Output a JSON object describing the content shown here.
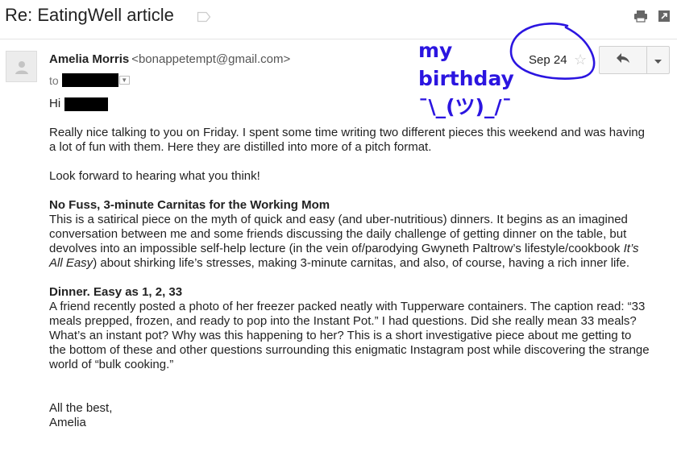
{
  "email": {
    "subject": "Re: EatingWell article",
    "sender_name": "Amelia Morris",
    "sender_email": "<bonappetempt@gmail.com>",
    "to_label": "to",
    "date": "Sep 24",
    "greeting": "Hi",
    "para1": "Really nice talking to you on Friday. I spent some time writing two different pieces this weekend and was having a lot of fun with them. Here they are distilled into more of a pitch format.",
    "para2": "Look forward to hearing what you think!",
    "pitch1_title": "No Fuss, 3-minute Carnitas for the Working Mom",
    "pitch1_body_a": "This is a satirical piece on the myth of quick and easy (and uber-nutritious) dinners. It begins as an imagined conversation between me and some friends discussing the daily challenge of getting dinner on the table, but devolves into an impossible self-help lecture (in the vein of/parodying Gwyneth Paltrow’s lifestyle/cookbook ",
    "pitch1_body_italic": "It’s All Easy",
    "pitch1_body_b": ") about shirking life’s stresses, making 3-minute carnitas, and also, of course, having a rich inner life.",
    "pitch2_title": "Dinner. Easy as 1, 2, 33",
    "pitch2_body": "A friend recently posted a photo of her freezer packed neatly with Tupperware containers. The caption read: “33 meals prepped, frozen, and ready to pop into the Instant Pot.” I had questions. Did she really mean 33 meals? What’s an instant pot? Why was this happening to her? This is a short investigative piece about me getting to the bottom of these and other questions surrounding this enigmatic Instagram post while discovering the strange world of “bulk cooking.”",
    "signoff": "All the best,",
    "signature": "Amelia"
  },
  "annotation": {
    "line1": "my",
    "line2": "birthday",
    "line3": "¯\\_(ツ)_/¯",
    "color": "#2b15e0"
  },
  "icons": {
    "label": "label-tag-icon",
    "print": "print-icon",
    "new_window": "new-window-icon",
    "avatar": "default-avatar-icon",
    "reply": "reply-icon",
    "more": "dropdown-arrow-icon",
    "star": "star-icon"
  }
}
